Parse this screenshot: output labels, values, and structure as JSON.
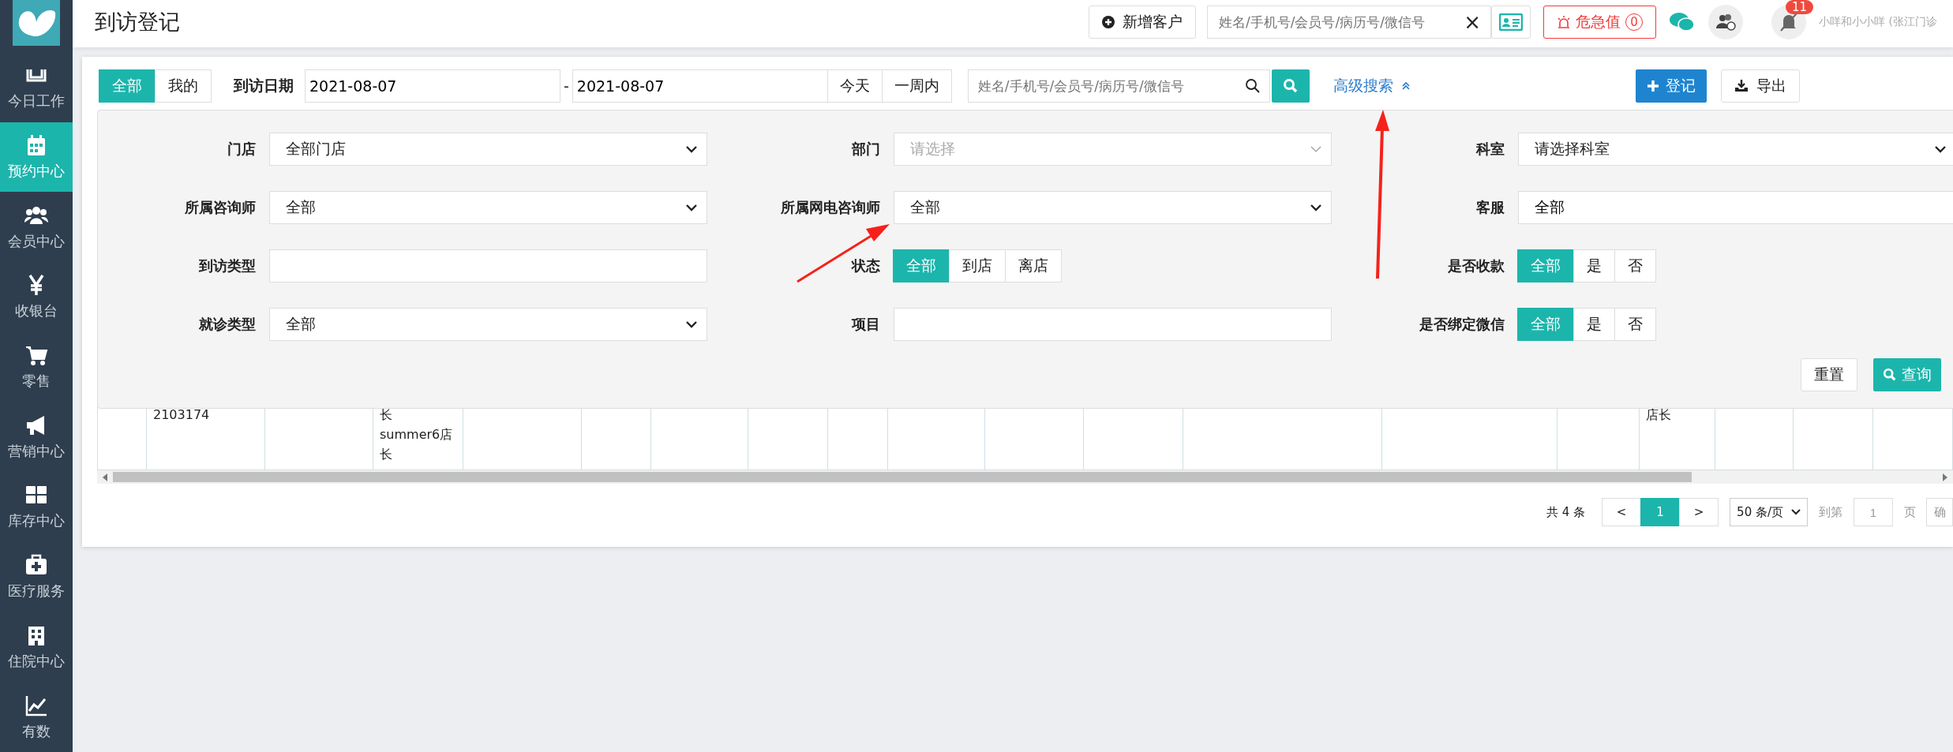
{
  "sidebar": {
    "items": [
      {
        "label": "今日工作",
        "selected": false
      },
      {
        "label": "预约中心",
        "selected": true
      },
      {
        "label": "会员中心",
        "selected": false
      },
      {
        "label": "收银台",
        "selected": false
      },
      {
        "label": "零售",
        "selected": false
      },
      {
        "label": "营销中心",
        "selected": false
      },
      {
        "label": "库存中心",
        "selected": false
      },
      {
        "label": "医疗服务",
        "selected": false
      },
      {
        "label": "住院中心",
        "selected": false
      },
      {
        "label": "有数",
        "selected": false
      }
    ]
  },
  "header": {
    "title": "到访登记",
    "new_customer": "新增客户",
    "search_placeholder": "姓名/手机号/会员号/病历号/微信号",
    "clear": "×",
    "critical_label": "危急值",
    "critical_count": "0",
    "notification_count": "11",
    "user": "小咩和小小咩 (张江门诊"
  },
  "toolbar": {
    "scope": [
      {
        "label": "全部",
        "selected": true
      },
      {
        "label": "我的",
        "selected": false
      }
    ],
    "date_label": "到访日期",
    "date_from": "2021-08-07",
    "date_separator": "-",
    "date_to": "2021-08-07",
    "quick_ranges": [
      "今天",
      "一周内"
    ],
    "search_placeholder": "姓名/手机号/会员号/病历号/微信号",
    "advanced_search": "高级搜索",
    "register": "登记",
    "export": "导出"
  },
  "advanced_panel": {
    "fields": [
      {
        "label": "门店",
        "kind": "select",
        "value": "全部门店"
      },
      {
        "label": "部门",
        "kind": "select",
        "placeholder": "请选择"
      },
      {
        "label": "科室",
        "kind": "select",
        "value": "请选择科室"
      },
      {
        "label": "所属咨询师",
        "kind": "select",
        "value": "全部"
      },
      {
        "label": "所属网电咨询师",
        "kind": "select",
        "value": "全部"
      },
      {
        "label": "客服",
        "kind": "input",
        "value": "全部"
      },
      {
        "label": "到访类型",
        "kind": "input"
      },
      {
        "label": "状态",
        "kind": "segment",
        "options": [
          {
            "label": "全部",
            "selected": true
          },
          {
            "label": "到店",
            "selected": false
          },
          {
            "label": "离店",
            "selected": false
          }
        ]
      },
      {
        "label": "是否收款",
        "kind": "segment",
        "options": [
          {
            "label": "全部",
            "selected": true
          },
          {
            "label": "是",
            "selected": false
          },
          {
            "label": "否",
            "selected": false
          }
        ]
      },
      {
        "label": "就诊类型",
        "kind": "select",
        "value": "全部"
      },
      {
        "label": "项目",
        "kind": "input"
      },
      {
        "label": "是否绑定微信",
        "kind": "segment",
        "options": [
          {
            "label": "全部",
            "selected": true
          },
          {
            "label": "是",
            "selected": false
          },
          {
            "label": "否",
            "selected": false
          }
        ]
      }
    ],
    "reset": "重置",
    "query": "查询"
  },
  "table": {
    "rows": [
      {
        "cells": [
          {},
          {
            "text": "2103174"
          },
          {},
          {
            "text": "长 summer6店长"
          },
          {},
          {},
          {},
          {},
          {},
          {},
          {},
          {},
          {},
          {},
          {},
          {
            "text": "店长"
          },
          {},
          {},
          {},
          {}
        ]
      }
    ]
  },
  "pagination": {
    "total": "共 4 条",
    "prev": "<",
    "pages": [
      {
        "label": "1",
        "selected": true
      }
    ],
    "next": ">",
    "page_size": "50 条/页",
    "goto": "到第",
    "goto_value": "1",
    "page_unit": "页",
    "confirm": "确"
  }
}
